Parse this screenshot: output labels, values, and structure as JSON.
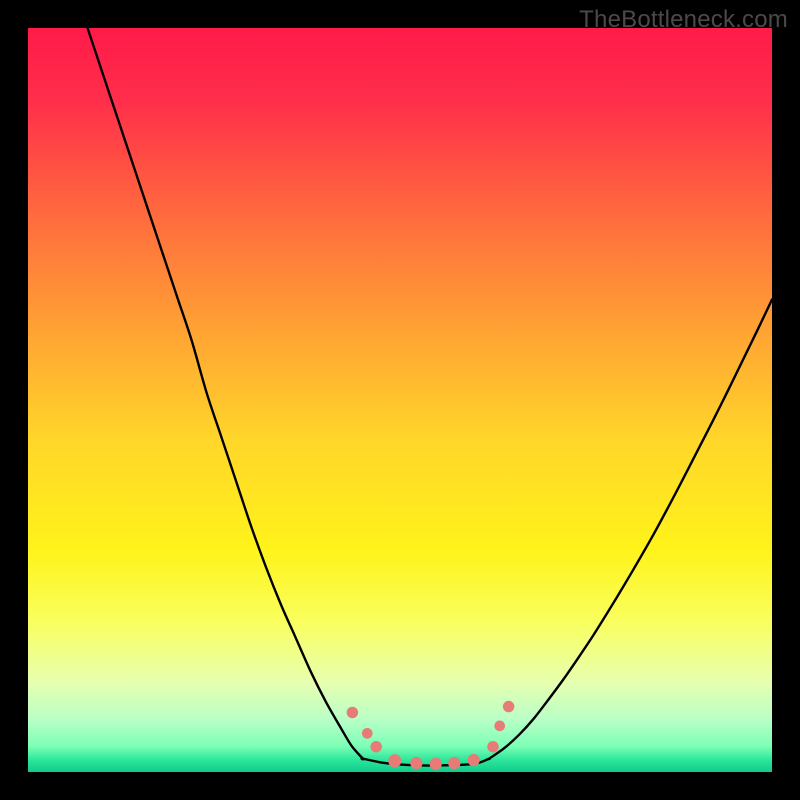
{
  "watermark": "TheBottleneck.com",
  "colors": {
    "frame": "#000000",
    "marker_fill": "#e77b78",
    "marker_stroke": "#c75a57",
    "curve": "#000000",
    "gradient_stops": [
      {
        "offset": 0.0,
        "color": "#ff1a4a"
      },
      {
        "offset": 0.1,
        "color": "#ff2f4a"
      },
      {
        "offset": 0.25,
        "color": "#ff6a3e"
      },
      {
        "offset": 0.4,
        "color": "#ffa034"
      },
      {
        "offset": 0.55,
        "color": "#ffd52a"
      },
      {
        "offset": 0.7,
        "color": "#fff31a"
      },
      {
        "offset": 0.8,
        "color": "#f9ff60"
      },
      {
        "offset": 0.88,
        "color": "#e6ffb0"
      },
      {
        "offset": 0.93,
        "color": "#b8ffc6"
      },
      {
        "offset": 0.965,
        "color": "#7dffb6"
      },
      {
        "offset": 0.985,
        "color": "#28e59a"
      },
      {
        "offset": 1.0,
        "color": "#12c98a"
      }
    ]
  },
  "chart_data": {
    "type": "line",
    "title": "",
    "xlabel": "",
    "ylabel": "",
    "xlim": [
      0,
      100
    ],
    "ylim": [
      0,
      100
    ],
    "grid": false,
    "legend": false,
    "series": [
      {
        "name": "left_curve",
        "x": [
          8,
          10,
          12,
          14,
          16,
          18,
          20,
          22,
          24,
          26,
          28,
          30,
          32,
          34,
          36,
          38,
          40,
          42,
          43.5,
          45
        ],
        "y": [
          100,
          94,
          88,
          82,
          76,
          70,
          64,
          58,
          51,
          45,
          39,
          33,
          27.5,
          22.5,
          18,
          13.5,
          9.5,
          6,
          3.5,
          1.8
        ]
      },
      {
        "name": "floor",
        "x": [
          45,
          48,
          52,
          56,
          60,
          62
        ],
        "y": [
          1.8,
          1.2,
          0.9,
          0.9,
          1.1,
          1.8
        ]
      },
      {
        "name": "right_curve",
        "x": [
          62,
          64,
          66,
          68,
          70,
          72,
          74,
          76,
          78,
          80,
          82,
          84,
          86,
          88,
          90,
          92,
          94,
          96,
          98,
          100
        ],
        "y": [
          1.8,
          3.2,
          5.0,
          7.2,
          9.8,
          12.5,
          15.4,
          18.4,
          21.6,
          24.9,
          28.3,
          31.8,
          35.5,
          39.3,
          43.2,
          47.1,
          51.1,
          55.2,
          59.3,
          63.5
        ]
      }
    ],
    "markers": [
      {
        "x": 43.6,
        "y": 8.0,
        "r": 1.4
      },
      {
        "x": 45.6,
        "y": 5.2,
        "r": 1.3
      },
      {
        "x": 46.8,
        "y": 3.4,
        "r": 1.4
      },
      {
        "x": 49.3,
        "y": 1.5,
        "r": 1.6
      },
      {
        "x": 52.2,
        "y": 1.2,
        "r": 1.5
      },
      {
        "x": 54.8,
        "y": 1.1,
        "r": 1.5
      },
      {
        "x": 57.3,
        "y": 1.2,
        "r": 1.5
      },
      {
        "x": 59.9,
        "y": 1.6,
        "r": 1.5
      },
      {
        "x": 62.5,
        "y": 3.4,
        "r": 1.4
      },
      {
        "x": 63.4,
        "y": 6.2,
        "r": 1.3
      },
      {
        "x": 64.6,
        "y": 8.8,
        "r": 1.4
      }
    ]
  }
}
